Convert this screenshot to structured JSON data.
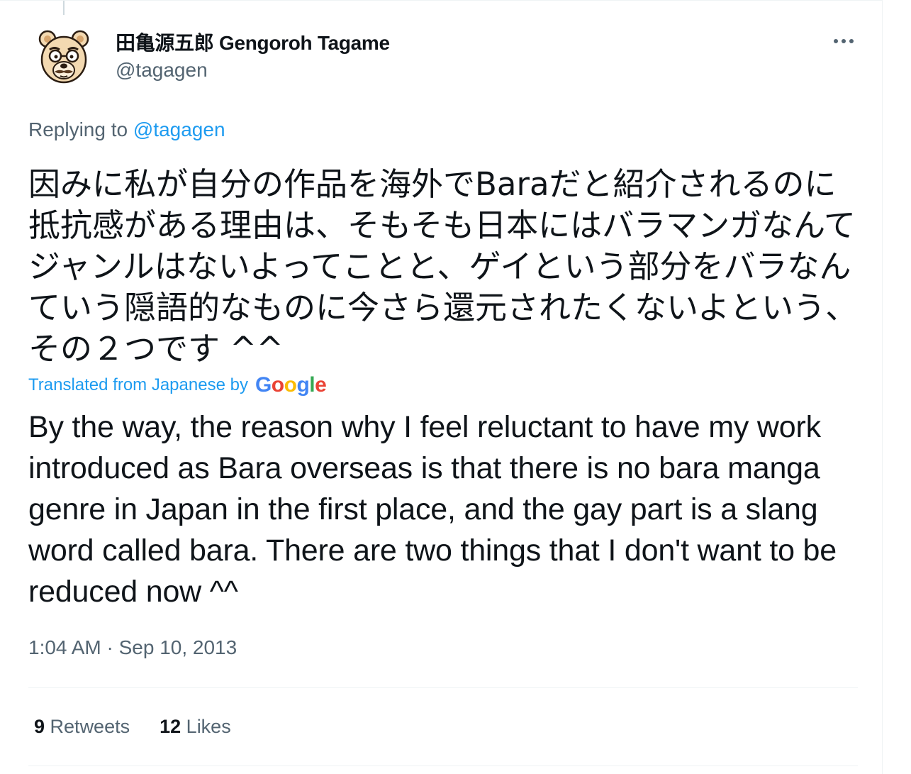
{
  "author": {
    "display_name": "田亀源五郎 Gengoroh Tagame",
    "handle": "@tagagen"
  },
  "reply": {
    "prefix": "Replying to",
    "mention": "@tagagen"
  },
  "tweet": {
    "original_text": "因みに私が自分の作品を海外でBaraだと紹介されるのに抵抗感がある理由は、そもそも日本にはバラマンガなんてジャンルはないよってことと、ゲイという部分をバラなんていう隠語的なものに今さら還元されたくないよという、その２つです ^^",
    "translated_label": "Translated from Japanese by",
    "translation_provider": "Google",
    "translated_text": "By the way, the reason why I feel reluctant to have my work introduced as Bara overseas is that there is no bara manga genre in Japan in the first place, and the gay part is a slang word called bara. There are two things that I don't want to be reduced now ^^",
    "timestamp": "1:04 AM · Sep 10, 2013"
  },
  "stats": {
    "retweets_count": "9",
    "retweets_label": "Retweets",
    "likes_count": "12",
    "likes_label": "Likes"
  },
  "icons": {
    "more": "more-horizontal-icon",
    "avatar": "bear-face-avatar"
  },
  "colors": {
    "link": "#1d9bf0",
    "secondary_text": "#536471",
    "primary_text": "#0f1419",
    "divider": "#eff3f4"
  }
}
